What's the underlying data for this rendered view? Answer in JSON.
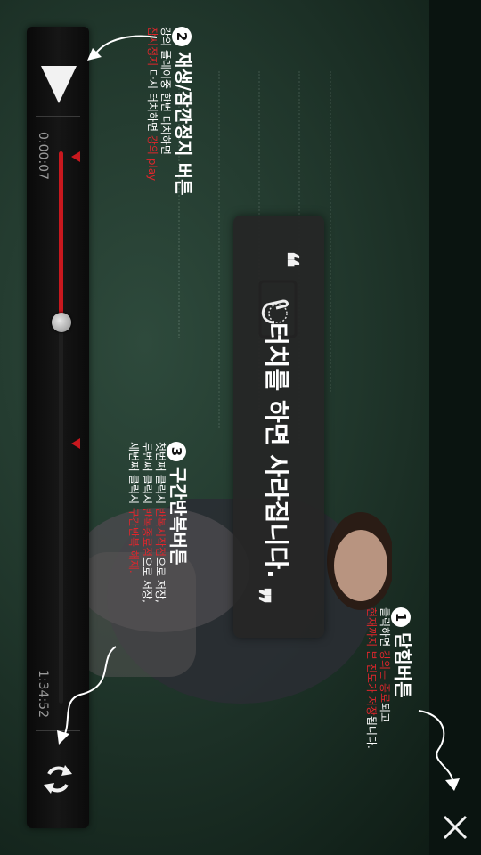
{
  "player": {
    "elapsed_time": "0:00:07",
    "total_time": "1:34:52",
    "progress_fraction": 0.31,
    "repeat_start_fraction": 0.0,
    "repeat_end_fraction": 0.52
  },
  "overlay": {
    "open_quote": "❝",
    "close_quote": "❞",
    "message": "터치를 하면 사라집니다."
  },
  "help": {
    "play_pause": {
      "number": "2",
      "title": "재생/잠깐정지 버튼",
      "line1": "강의 플레이중 한번 터치하면",
      "line2_red": "잠시정지",
      "line2_mid": " 다시 터치하면 ",
      "line2_red2": "강의 play"
    },
    "repeat": {
      "number": "3",
      "title": "구간반복버튼",
      "line1_a": "첫번째 클릭시 ",
      "line1_red": "반복시작점",
      "line1_b": "으로 저장,",
      "line2_a": "두번째 클릭시 ",
      "line2_red": "반복종료점",
      "line2_b": "으로 저장,",
      "line3_a": "세번째 클릭시 ",
      "line3_red": "구간반복 해제."
    },
    "close": {
      "number": "1",
      "title": "닫힘버튼",
      "line1_a": "클릭하면 ",
      "line1_red": "강의는 종료",
      "line1_b": "되고",
      "line2_red": "현재까지 본 진도가 저장",
      "line2_b": "됩니다."
    }
  },
  "icons": {
    "play": "play-icon",
    "repeat": "repeat-icon",
    "close": "close-icon",
    "touch": "touch-hand-icon"
  },
  "colors": {
    "accent_red": "#c8181e",
    "board_green": "#20362b"
  }
}
